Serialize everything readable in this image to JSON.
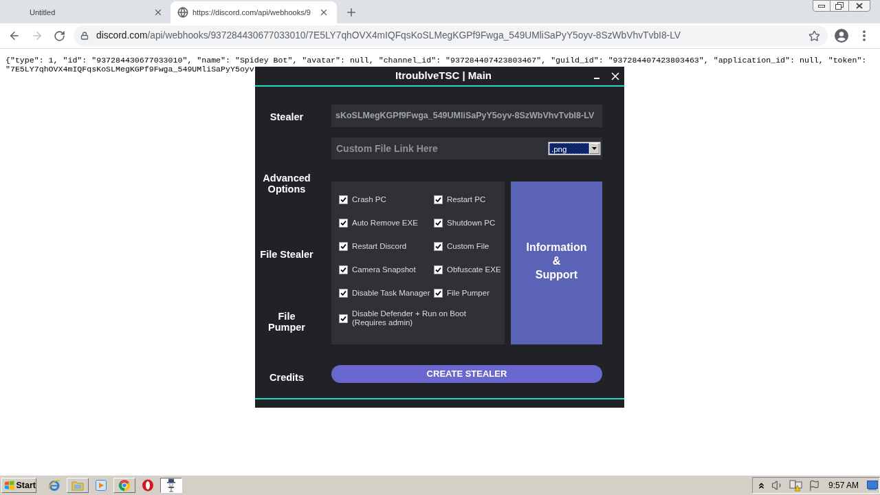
{
  "browser": {
    "tabs": [
      {
        "title": "Untitled",
        "selected": false
      },
      {
        "title": "https://discord.com/api/webhooks/9",
        "selected": true
      }
    ],
    "forward_disabled": true,
    "address_bar": {
      "host": "discord.com",
      "path": "/api/webhooks/937284430677033010/7E5LY7qhOVX4mIQFqsKoSLMegKGPf9Fwga_549UMliSaPyY5oyv-8SzWbVhvTvbI8-LV"
    }
  },
  "page_text": [
    "{\"type\": 1, \"id\": \"937284430677033010\", \"name\": \"Spidey Bot\", \"avatar\": null, \"channel_id\": \"937284407423803467\", \"guild_id\": \"937284407423803463\", \"application_id\": null, \"token\":",
    "\"7E5LY7qhOVX4mIQFqsKoSLMegKGPf9Fwga_549UMliSaPyY5oyv"
  ],
  "app_window": {
    "title": "ItroublveTSC | Main",
    "nav": [
      "Stealer",
      "Advanced Options",
      "File Stealer",
      "File Pumper",
      "Credits"
    ],
    "webhook_field": {
      "value": "sKoSLMegKGPf9Fwga_549UMliSaPyY5oyv-8SzWbVhvTvbI8-LV"
    },
    "custom_file_field": {
      "placeholder": "Custom File Link Here"
    },
    "file_type_select": {
      "value": ".png"
    },
    "options": [
      {
        "label": "Crash PC",
        "checked": true
      },
      {
        "label": "Restart PC",
        "checked": true
      },
      {
        "label": "Auto Remove EXE",
        "checked": true
      },
      {
        "label": "Shutdown PC",
        "checked": true
      },
      {
        "label": "Restart Discord",
        "checked": true
      },
      {
        "label": "Custom File",
        "checked": true
      },
      {
        "label": "Camera Snapshot",
        "checked": true
      },
      {
        "label": "Obfuscate EXE",
        "checked": true
      },
      {
        "label": "Disable Task Manager",
        "checked": true
      },
      {
        "label": "File Pumper",
        "checked": true
      },
      {
        "label": "Disable Defender + Run on Boot\n(Requires admin)",
        "checked": true
      }
    ],
    "info_button": "Information\n&\nSupport",
    "create_button": "CREATE STEALER"
  },
  "taskbar": {
    "start": "Start",
    "apps": [
      {
        "kind": "orbit",
        "running": false,
        "selected": false
      },
      {
        "kind": "folder",
        "running": true,
        "selected": false
      },
      {
        "kind": "play",
        "running": false,
        "selected": false
      },
      {
        "kind": "segmented",
        "running": true,
        "selected": false
      },
      {
        "kind": "ring",
        "running": false,
        "selected": false
      },
      {
        "kind": "figure",
        "running": true,
        "selected": true
      }
    ],
    "clock": "9:57 AM"
  }
}
